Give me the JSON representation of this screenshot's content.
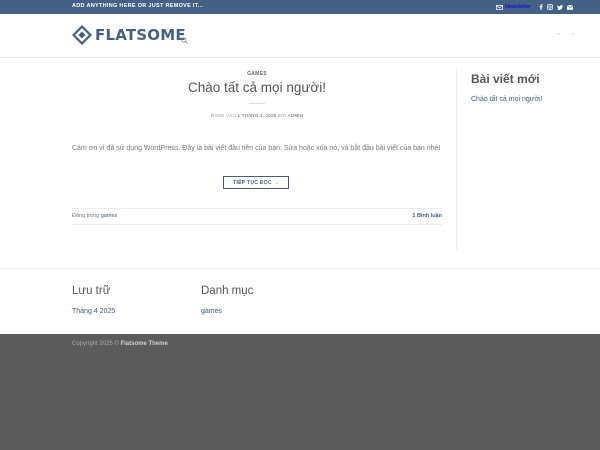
{
  "topbar": {
    "message": "ADD ANYTHING HERE OR JUST REMOVE IT...",
    "newsletter_label": "Newsletter",
    "social_icons": [
      "facebook-icon",
      "instagram-icon",
      "twitter-icon",
      "email-icon"
    ]
  },
  "header": {
    "logo_text": "FLATSOME",
    "nav_icons": [
      "search-icon"
    ]
  },
  "post": {
    "category": "GAMES",
    "title": "Chào tất cả mọi người!",
    "meta_prefix": "ĐĂNG VÀO",
    "meta_date": "1 THÁNG 4, 2025",
    "meta_by": "BỞI",
    "meta_author": "ADMIN",
    "excerpt": "Cảm ơn vì đã sử dụng WordPress. Đây là bài viết đầu tiên của bạn. Sửa hoặc xóa nó, và bắt đầu bài viết của bạn nhé!",
    "read_more": "TIẾP TỤC ĐỌC →",
    "footer_prefix": "Đăng trong",
    "footer_category": "games",
    "comments": "1 Bình luận"
  },
  "sidebar": {
    "widget_title": "Bài viết mới",
    "recent_posts": [
      "Chào tất cả mọi người!"
    ]
  },
  "footer_widgets": {
    "archive_title": "Lưu trữ",
    "archive_items": [
      "Tháng 4 2025"
    ],
    "categories_title": "Danh mục",
    "category_items": [
      "games"
    ]
  },
  "footer": {
    "copyright_prefix": "Copyright 2025 ©",
    "copyright_brand": "Flatsome Theme"
  },
  "colors": {
    "primary": "#446084",
    "footer_bg": "#5b5b5b"
  }
}
